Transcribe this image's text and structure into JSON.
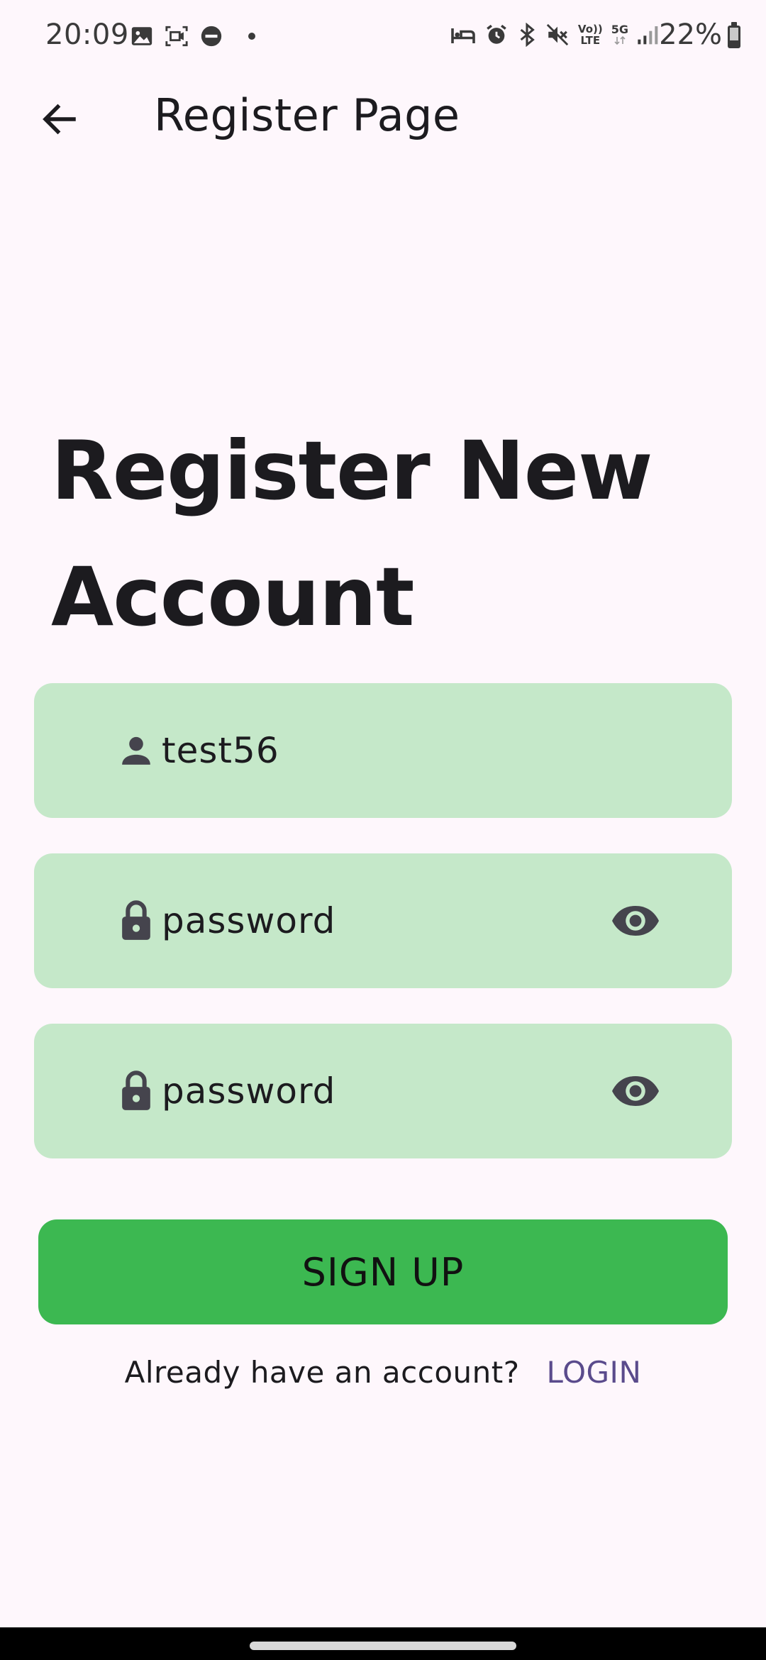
{
  "status_bar": {
    "time": "20:09",
    "battery_text": "22%",
    "left_icons": [
      "image-icon",
      "screen-record-icon",
      "do-not-disturb-icon",
      "dot-icon"
    ],
    "right_icons": [
      "sleep-mode-icon",
      "alarm-icon",
      "bluetooth-icon",
      "mute-icon",
      "volte-icon",
      "5g-icon",
      "signal-icon"
    ],
    "volte_label_top": "Vo))",
    "volte_label_bottom": "LTE",
    "network_label": "5G"
  },
  "app_bar": {
    "title": "Register Page",
    "back_icon": "arrow-back-icon"
  },
  "heading": "Register New Account",
  "form": {
    "username": {
      "value": "test56",
      "icon": "person-icon"
    },
    "password": {
      "value": "password",
      "icon": "lock-icon",
      "toggle_icon": "eye-icon"
    },
    "confirm_password": {
      "value": "password",
      "icon": "lock-icon",
      "toggle_icon": "eye-icon"
    },
    "field_color": "#c5e8c9"
  },
  "signup_button": {
    "label": "SIGN UP",
    "color": "#3cb851"
  },
  "login_row": {
    "prompt": "Already have an account?",
    "link": "LOGIN",
    "link_color": "#5a4b8c"
  }
}
